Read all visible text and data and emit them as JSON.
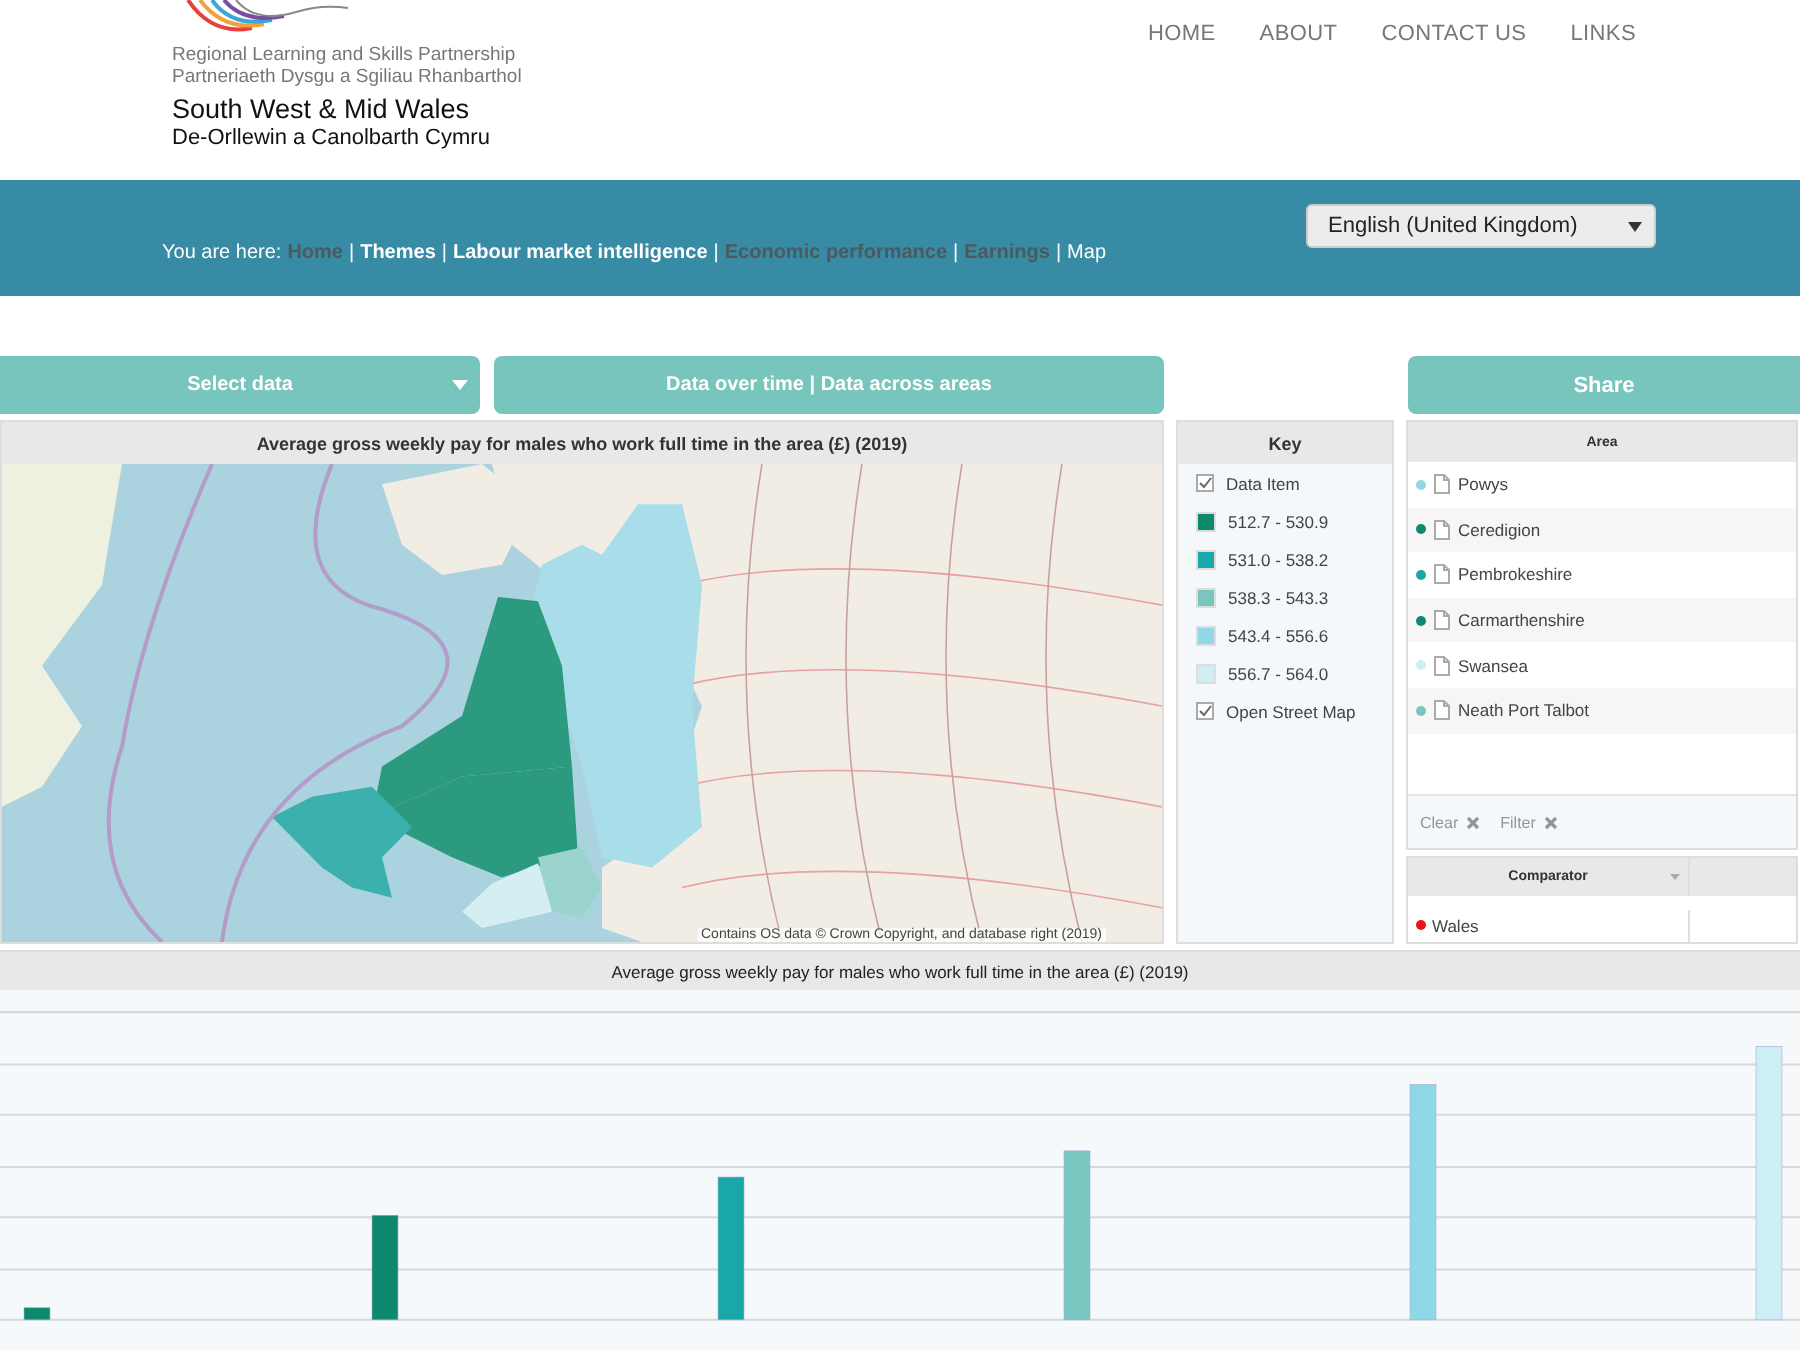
{
  "logo": {
    "lines": [
      "Regional Learning and Skills Partnership",
      "Partneriaeth Dysgu a Sgiliau Rhanbarthol",
      "South West & Mid Wales",
      "De-Orllewin a Canolbarth Cymru"
    ]
  },
  "nav": [
    "HOME",
    "ABOUT",
    "CONTACT US",
    "LINKS"
  ],
  "breadcrumb": {
    "label": "You are here:",
    "separator": "|",
    "items": [
      {
        "text": "Home",
        "kind": "visited"
      },
      {
        "text": "Themes",
        "kind": "link"
      },
      {
        "text": "Labour market intelligence",
        "kind": "link"
      },
      {
        "text": "Economic performance",
        "kind": "visited"
      },
      {
        "text": "Earnings",
        "kind": "visited"
      },
      {
        "text": "Map",
        "kind": "current"
      }
    ]
  },
  "language_select": {
    "value": "English (United Kingdom)"
  },
  "toolbar": {
    "select_data": "Select data",
    "views": "Data over time | Data across areas",
    "share": "Share"
  },
  "map_panel": {
    "title": "Average gross weekly pay for males who work full time in the area (£) (2019)",
    "attribution": "Contains OS data © Crown Copyright, and database right (2019)"
  },
  "key": {
    "title": "Key",
    "items": [
      {
        "kind": "checkbox",
        "label": "Data Item",
        "checked": true
      },
      {
        "kind": "swatch",
        "label": "512.7 - 530.9",
        "color": "#0d8a6e"
      },
      {
        "kind": "swatch",
        "label": "531.0 - 538.2",
        "color": "#1aa7a7"
      },
      {
        "kind": "swatch",
        "label": "538.3 - 543.3",
        "color": "#77c6bf"
      },
      {
        "kind": "swatch",
        "label": "543.4 - 556.6",
        "color": "#8ed8e8"
      },
      {
        "kind": "swatch",
        "label": "556.7 - 564.0",
        "color": "#cdeef4"
      },
      {
        "kind": "checkbox",
        "label": "Open Street Map",
        "checked": true
      }
    ]
  },
  "area_table": {
    "header": "Area",
    "rows": [
      {
        "name": "Powys",
        "color": "#8ed8e8"
      },
      {
        "name": "Ceredigion",
        "color": "#0d8a6e"
      },
      {
        "name": "Pembrokeshire",
        "color": "#1aa7a7"
      },
      {
        "name": "Carmarthenshire",
        "color": "#0d8a6e"
      },
      {
        "name": "Swansea",
        "color": "#cdeef4"
      },
      {
        "name": "Neath Port Talbot",
        "color": "#77c6bf"
      }
    ],
    "actions": [
      {
        "label": "Clear",
        "disabled": true
      },
      {
        "label": "Filter",
        "disabled": true
      }
    ]
  },
  "comparator_table": {
    "header": "Comparator",
    "rows": [
      {
        "name": "Wales",
        "color": "#e8131b"
      }
    ]
  },
  "chart_panel": {
    "title": "Average gross weekly pay for males who work full time in the area (£) (2019)"
  }
}
